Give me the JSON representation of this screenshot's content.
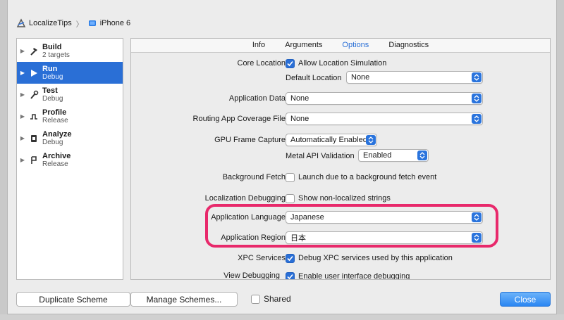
{
  "breadcrumb": {
    "project": "LocalizeTips",
    "device": "iPhone 6"
  },
  "actions": [
    {
      "name": "Build",
      "sub": "2 targets",
      "icon": "hammer-icon"
    },
    {
      "name": "Run",
      "sub": "Debug",
      "icon": "play-icon",
      "selected": true
    },
    {
      "name": "Test",
      "sub": "Debug",
      "icon": "wrench-icon"
    },
    {
      "name": "Profile",
      "sub": "Release",
      "icon": "gauge-icon"
    },
    {
      "name": "Analyze",
      "sub": "Debug",
      "icon": "analyze-icon"
    },
    {
      "name": "Archive",
      "sub": "Release",
      "icon": "archive-icon"
    }
  ],
  "tabs": {
    "info": "Info",
    "arguments": "Arguments",
    "options": "Options",
    "diagnostics": "Diagnostics",
    "active": "Options"
  },
  "options": {
    "core_location_label": "Core Location",
    "allow_location_sim": "Allow Location Simulation",
    "default_location_label": "Default Location",
    "default_location_value": "None",
    "app_data_label": "Application Data",
    "app_data_value": "None",
    "routing_label": "Routing App Coverage File",
    "routing_value": "None",
    "gpu_label": "GPU Frame Capture",
    "gpu_value": "Automatically Enabled",
    "metal_label": "Metal API Validation",
    "metal_value": "Enabled",
    "bg_fetch_label": "Background Fetch",
    "bg_fetch_text": "Launch due to a background fetch event",
    "loc_debug_label": "Localization Debugging",
    "loc_debug_text": "Show non-localized strings",
    "app_lang_label": "Application Language",
    "app_lang_value": "Japanese",
    "app_region_label": "Application Region",
    "app_region_value": "日本",
    "xpc_label": "XPC Services",
    "xpc_text": "Debug XPC services used by this application",
    "view_debug_label": "View Debugging",
    "view_debug_text": "Enable user interface debugging"
  },
  "buttons": {
    "duplicate": "Duplicate Scheme",
    "manage": "Manage Schemes...",
    "shared": "Shared",
    "close": "Close"
  },
  "colors": {
    "accent": "#2a6fd6",
    "highlight": "#e8296b"
  }
}
